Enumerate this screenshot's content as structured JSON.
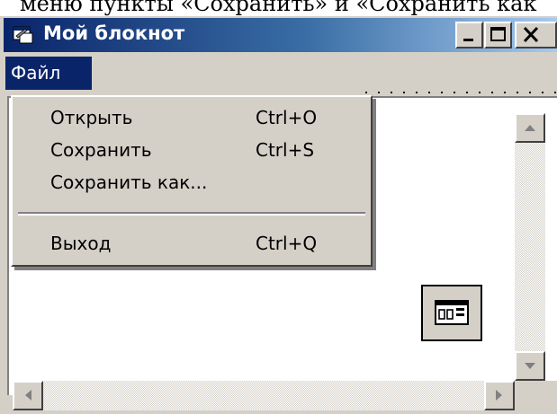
{
  "caption": {
    "text": "меню пункты «Сохранить» и «Сохранить как"
  },
  "window": {
    "title": "Мой блокнот",
    "icon": "notepad-app-icon",
    "controls": {
      "minimize": "minimize-icon",
      "maximize": "maximize-icon",
      "close": "close-icon"
    }
  },
  "menubar": {
    "file": "Файл"
  },
  "file_menu": {
    "items": [
      {
        "label": "Открыть",
        "shortcut": "Ctrl+O"
      },
      {
        "label": "Сохранить",
        "shortcut": "Ctrl+S"
      },
      {
        "label": "Сохранить как...",
        "shortcut": ""
      },
      {
        "label": "Выход",
        "shortcut": "Ctrl+Q"
      }
    ]
  },
  "designer": {
    "form_component_icon": "form-component-icon"
  },
  "colors": {
    "title_gradient_start": "#0a246a",
    "title_gradient_end": "#a6caf0",
    "face": "#d4d0c8",
    "highlight": "#0a246a"
  }
}
